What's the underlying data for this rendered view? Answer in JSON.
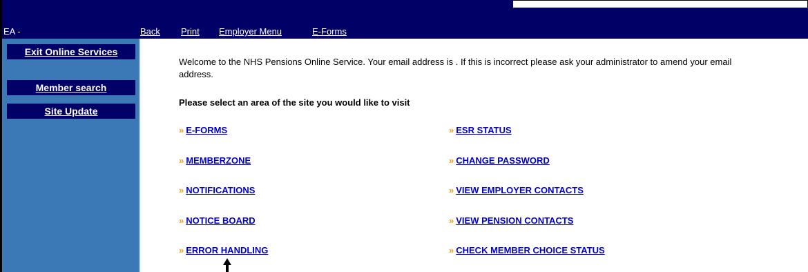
{
  "nav": {
    "ea_label": "EA -",
    "back": "Back",
    "print": "Print",
    "employer_menu": "Employer Menu",
    "eforms": "E-Forms"
  },
  "sidebar": {
    "exit": "Exit Online Services",
    "member_search": "Member search",
    "site_update": "Site Update"
  },
  "main": {
    "welcome": "Welcome to the NHS Pensions Online Service. Your email address is . If this is incorrect please ask your administrator to amend your email address.",
    "select_prompt": "Please select an area of the site you would like to visit",
    "bullet": "»",
    "links_left": [
      "E-FORMS",
      "MEMBERZONE",
      "NOTIFICATIONS",
      "NOTICE BOARD",
      "ERROR HANDLING"
    ],
    "links_right": [
      "ESR STATUS",
      "CHANGE PASSWORD",
      "VIEW EMPLOYER CONTACTS",
      "VIEW PENSION CONTACTS",
      "CHECK MEMBER CHOICE STATUS"
    ]
  },
  "colors": {
    "nav_bg": "#000066",
    "sidebar_bg": "#3a78b6",
    "link": "#0000cc",
    "bullet": "#f0a020"
  }
}
